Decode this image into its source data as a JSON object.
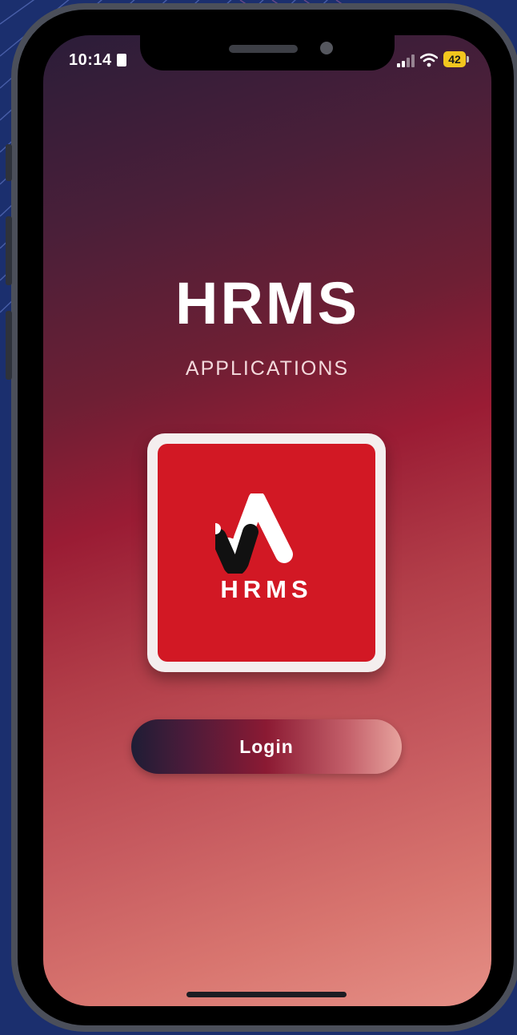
{
  "status_bar": {
    "time": "10:14",
    "battery_level": "42"
  },
  "app": {
    "title": "HRMS",
    "subtitle": "APPLICATIONS"
  },
  "logo": {
    "text": "HRMS",
    "tile_color": "#d21824"
  },
  "login_button": {
    "label": "Login"
  },
  "colors": {
    "page_background": "#1b2f6e",
    "accent_red": "#d21824",
    "battery": "#f2c61e"
  },
  "icons": [
    "signal-icon",
    "wifi-icon",
    "battery-icon",
    "hrms-logo-icon"
  ]
}
